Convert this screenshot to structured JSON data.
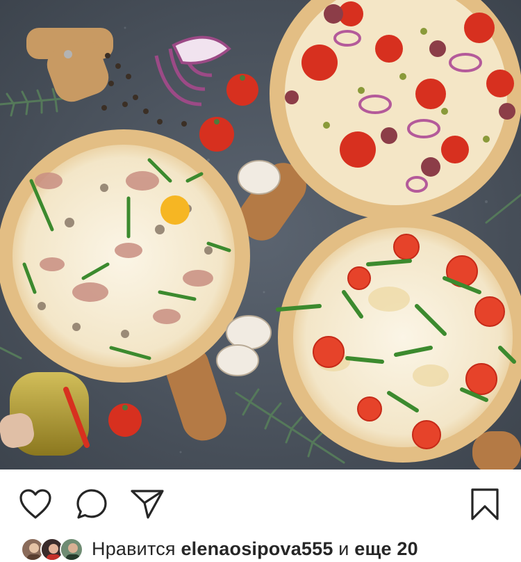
{
  "photo": {
    "alt": ""
  },
  "actions": {
    "like_icon": "heart-outline-icon",
    "comment_icon": "speech-bubble-icon",
    "share_icon": "paper-plane-icon",
    "save_icon": "bookmark-outline-icon"
  },
  "likes": {
    "prefix": "Нравится",
    "user": "elenaosipova555",
    "connector": "и",
    "more": "еще 20"
  },
  "colors": {
    "stone_bg": "#4d5560",
    "crust": "#f0d9a8",
    "board": "#b47a45",
    "tomato": "#d7301f",
    "arugula": "#3c8a2e",
    "text": "#262626"
  }
}
